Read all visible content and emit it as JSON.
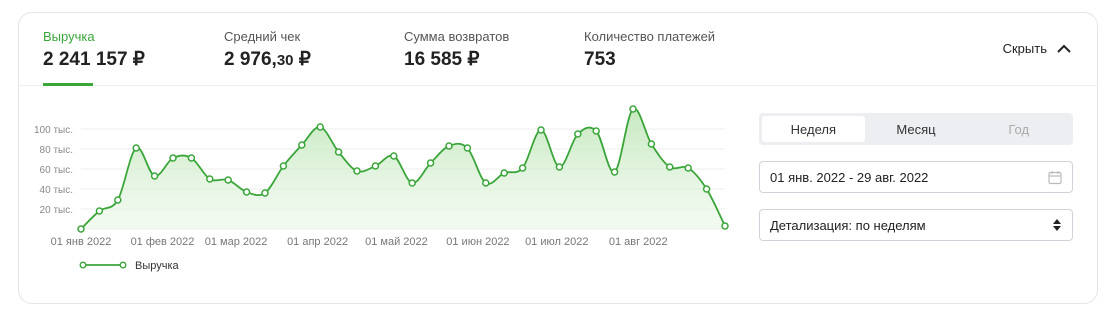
{
  "metrics": [
    {
      "label": "Выручка",
      "value": "2 241 157 ₽",
      "active": true
    },
    {
      "label": "Средний чек",
      "value_main": "2 976,",
      "value_small": "30",
      "value_suffix": " ₽"
    },
    {
      "label": "Сумма возвратов",
      "value": "16 585 ₽"
    },
    {
      "label": "Количество платежей",
      "value": "753"
    }
  ],
  "hide_label": "Скрыть",
  "icons": {
    "collapse": "chevron-up-icon",
    "calendar": "calendar-icon",
    "select": "select-arrows-icon"
  },
  "colors": {
    "accent": "#3aa63a",
    "fill": "#d9f0d5"
  },
  "period_tabs": [
    {
      "label": "Неделя",
      "active": true
    },
    {
      "label": "Месяц"
    },
    {
      "label": "Год",
      "disabled": true
    }
  ],
  "date_range": "01 янв. 2022 - 29 авг. 2022",
  "detail_select": "Детализация: по неделям",
  "chart_data": {
    "type": "area",
    "series": [
      {
        "name": "Выручка",
        "values": [
          0,
          18,
          29,
          81,
          53,
          71,
          71,
          50,
          49,
          37,
          36,
          63,
          84,
          102,
          77,
          58,
          63,
          73,
          46,
          66,
          83,
          81,
          46,
          56,
          61,
          99,
          62,
          95,
          98,
          57,
          120,
          85,
          62,
          61,
          40,
          3
        ]
      }
    ],
    "x_start": "01 янв 2022",
    "x_ticks": [
      "01 янв 2022",
      "01 фев 2022",
      "01 мар 2022",
      "01 апр 2022",
      "01 май 2022",
      "01 июн 2022",
      "01 июл 2022",
      "01 авг 2022"
    ],
    "y_ticks": [
      "20 тыс.",
      "40 тыс.",
      "60 тыс.",
      "80 тыс.",
      "100 тыс."
    ],
    "y_tick_values": [
      20,
      40,
      60,
      80,
      100
    ],
    "ylim": [
      0,
      120
    ],
    "legend": "bottom-left",
    "grid": true
  }
}
